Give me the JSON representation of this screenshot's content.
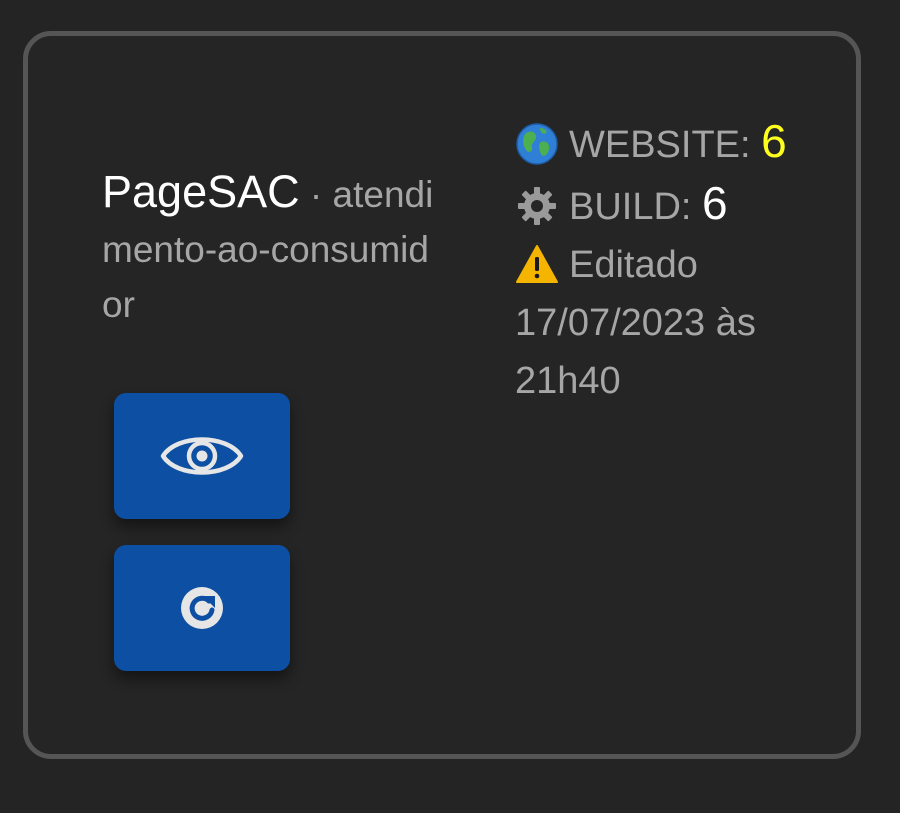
{
  "project": {
    "name": "PageSAC",
    "separator": " · ",
    "slug": "atendimento-ao-consumidor"
  },
  "stats": {
    "website_label": "WEBSITE:",
    "website_value": "6",
    "build_label": "BUILD:",
    "build_value": "6",
    "edited_label": "Editado",
    "edited_date": "17/07/2023 às",
    "edited_time": "21h40"
  },
  "icons": {
    "website": "globe-icon",
    "build": "gear-icon",
    "edited": "warning-icon",
    "view_button": "eye-icon",
    "rebuild_button": "refresh-icon"
  },
  "colors": {
    "background": "#242424",
    "card_border": "#555555",
    "button": "#0d4fa3",
    "website_value": "#ffff1f",
    "build_value": "#ffffff",
    "muted_text": "#a6a6a6"
  }
}
